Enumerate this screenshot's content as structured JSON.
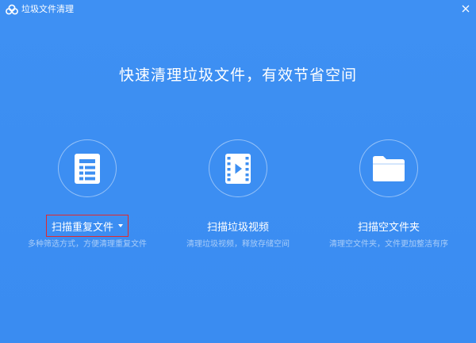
{
  "window": {
    "title": "垃圾文件清理",
    "app_icon": "cloud-logo-icon",
    "close_icon": "close-icon"
  },
  "headline": "快速清理垃圾文件，有效节省空间",
  "options": [
    {
      "icon": "document-list-icon",
      "label": "扫描重复文件",
      "has_dropdown": true,
      "selected": true,
      "description": "多种筛选方式，方便清理重复文件"
    },
    {
      "icon": "video-file-icon",
      "label": "扫描垃圾视频",
      "has_dropdown": false,
      "selected": false,
      "description": "清理垃圾视频，释放存储空间"
    },
    {
      "icon": "folder-icon",
      "label": "扫描空文件夹",
      "has_dropdown": false,
      "selected": false,
      "description": "清理空文件夹，文件更加整洁有序"
    }
  ],
  "colors": {
    "background": "#3d8ff2",
    "selection_border": "#e2292c",
    "icon_tile": "#ffffff",
    "icon_glyph": "#3d8ff2"
  }
}
